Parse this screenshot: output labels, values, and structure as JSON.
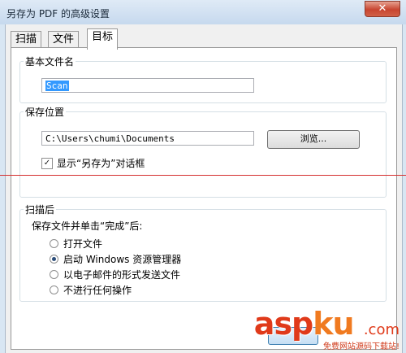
{
  "window": {
    "title": "另存为 PDF 的高级设置",
    "close_glyph": "✕"
  },
  "tabs": [
    "扫描",
    "文件",
    "目标"
  ],
  "basic_name": {
    "label": "基本文件名",
    "value": "Scan"
  },
  "save_location": {
    "label": "保存位置",
    "path": "C:\\Users\\chumi\\Documents",
    "browse_label": "浏览...",
    "show_dialog_label": "显示“另存为”对话框",
    "show_dialog_checked": true
  },
  "after_scan": {
    "label": "扫描后",
    "subtitle": "保存文件并单击“完成”后:",
    "options": [
      "打开文件",
      "启动 Windows 资源管理器",
      "以电子邮件的形式发送文件",
      "不进行任何操作"
    ],
    "selected_index": 1
  },
  "watermark": {
    "brand_a": "asp",
    "brand_b": "ku",
    "dot": ".com",
    "sub": "免费网站源码下载站!"
  },
  "colors": {
    "accent": "#3399ff",
    "close": "#c84530",
    "divider": "#d43030"
  }
}
